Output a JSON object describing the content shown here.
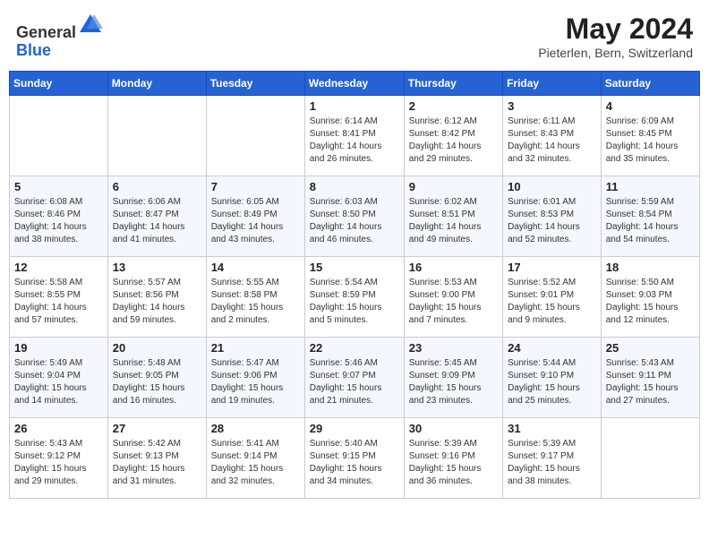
{
  "header": {
    "logo": {
      "line1": "General",
      "line2": "Blue"
    },
    "month": "May 2024",
    "location": "Pieterlen, Bern, Switzerland"
  },
  "weekdays": [
    "Sunday",
    "Monday",
    "Tuesday",
    "Wednesday",
    "Thursday",
    "Friday",
    "Saturday"
  ],
  "weeks": [
    [
      {
        "day": "",
        "info": ""
      },
      {
        "day": "",
        "info": ""
      },
      {
        "day": "",
        "info": ""
      },
      {
        "day": "1",
        "info": "Sunrise: 6:14 AM\nSunset: 8:41 PM\nDaylight: 14 hours\nand 26 minutes."
      },
      {
        "day": "2",
        "info": "Sunrise: 6:12 AM\nSunset: 8:42 PM\nDaylight: 14 hours\nand 29 minutes."
      },
      {
        "day": "3",
        "info": "Sunrise: 6:11 AM\nSunset: 8:43 PM\nDaylight: 14 hours\nand 32 minutes."
      },
      {
        "day": "4",
        "info": "Sunrise: 6:09 AM\nSunset: 8:45 PM\nDaylight: 14 hours\nand 35 minutes."
      }
    ],
    [
      {
        "day": "5",
        "info": "Sunrise: 6:08 AM\nSunset: 8:46 PM\nDaylight: 14 hours\nand 38 minutes."
      },
      {
        "day": "6",
        "info": "Sunrise: 6:06 AM\nSunset: 8:47 PM\nDaylight: 14 hours\nand 41 minutes."
      },
      {
        "day": "7",
        "info": "Sunrise: 6:05 AM\nSunset: 8:49 PM\nDaylight: 14 hours\nand 43 minutes."
      },
      {
        "day": "8",
        "info": "Sunrise: 6:03 AM\nSunset: 8:50 PM\nDaylight: 14 hours\nand 46 minutes."
      },
      {
        "day": "9",
        "info": "Sunrise: 6:02 AM\nSunset: 8:51 PM\nDaylight: 14 hours\nand 49 minutes."
      },
      {
        "day": "10",
        "info": "Sunrise: 6:01 AM\nSunset: 8:53 PM\nDaylight: 14 hours\nand 52 minutes."
      },
      {
        "day": "11",
        "info": "Sunrise: 5:59 AM\nSunset: 8:54 PM\nDaylight: 14 hours\nand 54 minutes."
      }
    ],
    [
      {
        "day": "12",
        "info": "Sunrise: 5:58 AM\nSunset: 8:55 PM\nDaylight: 14 hours\nand 57 minutes."
      },
      {
        "day": "13",
        "info": "Sunrise: 5:57 AM\nSunset: 8:56 PM\nDaylight: 14 hours\nand 59 minutes."
      },
      {
        "day": "14",
        "info": "Sunrise: 5:55 AM\nSunset: 8:58 PM\nDaylight: 15 hours\nand 2 minutes."
      },
      {
        "day": "15",
        "info": "Sunrise: 5:54 AM\nSunset: 8:59 PM\nDaylight: 15 hours\nand 5 minutes."
      },
      {
        "day": "16",
        "info": "Sunrise: 5:53 AM\nSunset: 9:00 PM\nDaylight: 15 hours\nand 7 minutes."
      },
      {
        "day": "17",
        "info": "Sunrise: 5:52 AM\nSunset: 9:01 PM\nDaylight: 15 hours\nand 9 minutes."
      },
      {
        "day": "18",
        "info": "Sunrise: 5:50 AM\nSunset: 9:03 PM\nDaylight: 15 hours\nand 12 minutes."
      }
    ],
    [
      {
        "day": "19",
        "info": "Sunrise: 5:49 AM\nSunset: 9:04 PM\nDaylight: 15 hours\nand 14 minutes."
      },
      {
        "day": "20",
        "info": "Sunrise: 5:48 AM\nSunset: 9:05 PM\nDaylight: 15 hours\nand 16 minutes."
      },
      {
        "day": "21",
        "info": "Sunrise: 5:47 AM\nSunset: 9:06 PM\nDaylight: 15 hours\nand 19 minutes."
      },
      {
        "day": "22",
        "info": "Sunrise: 5:46 AM\nSunset: 9:07 PM\nDaylight: 15 hours\nand 21 minutes."
      },
      {
        "day": "23",
        "info": "Sunrise: 5:45 AM\nSunset: 9:09 PM\nDaylight: 15 hours\nand 23 minutes."
      },
      {
        "day": "24",
        "info": "Sunrise: 5:44 AM\nSunset: 9:10 PM\nDaylight: 15 hours\nand 25 minutes."
      },
      {
        "day": "25",
        "info": "Sunrise: 5:43 AM\nSunset: 9:11 PM\nDaylight: 15 hours\nand 27 minutes."
      }
    ],
    [
      {
        "day": "26",
        "info": "Sunrise: 5:43 AM\nSunset: 9:12 PM\nDaylight: 15 hours\nand 29 minutes."
      },
      {
        "day": "27",
        "info": "Sunrise: 5:42 AM\nSunset: 9:13 PM\nDaylight: 15 hours\nand 31 minutes."
      },
      {
        "day": "28",
        "info": "Sunrise: 5:41 AM\nSunset: 9:14 PM\nDaylight: 15 hours\nand 32 minutes."
      },
      {
        "day": "29",
        "info": "Sunrise: 5:40 AM\nSunset: 9:15 PM\nDaylight: 15 hours\nand 34 minutes."
      },
      {
        "day": "30",
        "info": "Sunrise: 5:39 AM\nSunset: 9:16 PM\nDaylight: 15 hours\nand 36 minutes."
      },
      {
        "day": "31",
        "info": "Sunrise: 5:39 AM\nSunset: 9:17 PM\nDaylight: 15 hours\nand 38 minutes."
      },
      {
        "day": "",
        "info": ""
      }
    ]
  ]
}
